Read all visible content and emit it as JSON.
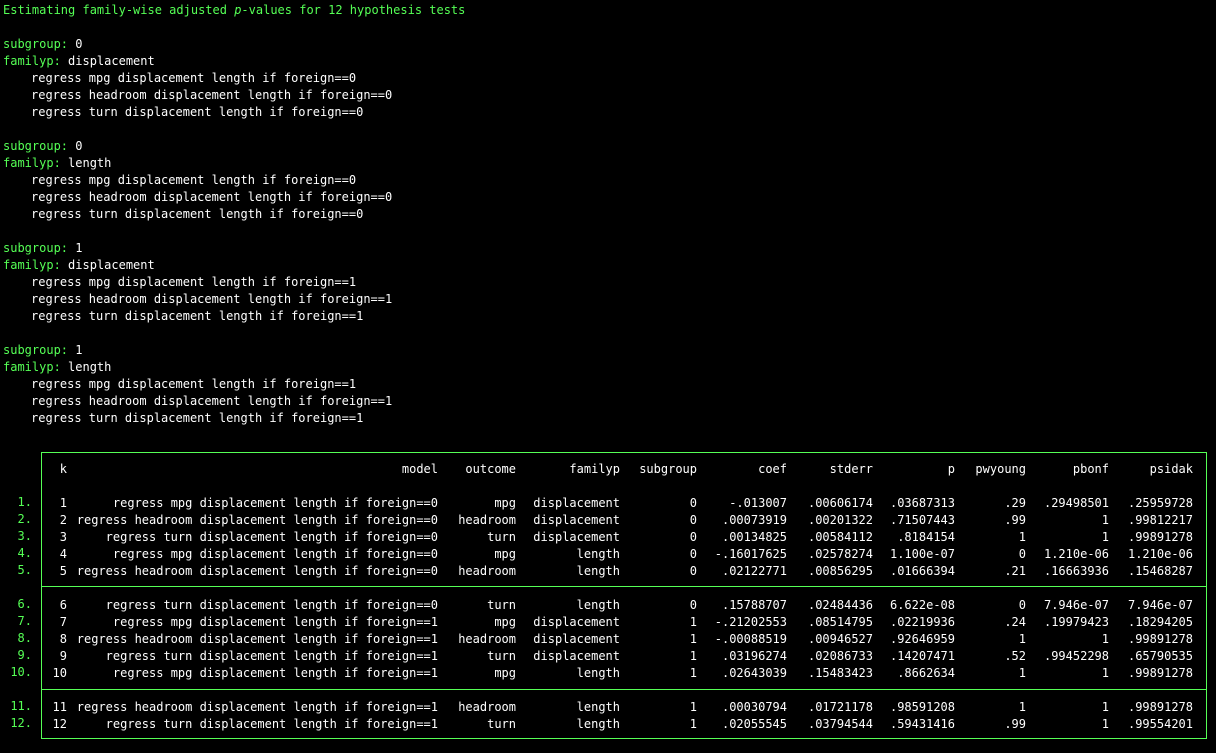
{
  "heading": {
    "prefix": "Estimating family-wise adjusted ",
    "italic": "p",
    "suffix": "-values for 12 hypothesis tests"
  },
  "blocks": [
    {
      "subgroup_label": "subgroup:",
      "subgroup_value": "0",
      "familyp_label": "familyp:",
      "familyp_value": "displacement",
      "commands": [
        "regress mpg displacement length if foreign==0",
        "regress headroom displacement length if foreign==0",
        "regress turn displacement length if foreign==0"
      ]
    },
    {
      "subgroup_label": "subgroup:",
      "subgroup_value": "0",
      "familyp_label": "familyp:",
      "familyp_value": "length",
      "commands": [
        "regress mpg displacement length if foreign==0",
        "regress headroom displacement length if foreign==0",
        "regress turn displacement length if foreign==0"
      ]
    },
    {
      "subgroup_label": "subgroup:",
      "subgroup_value": "1",
      "familyp_label": "familyp:",
      "familyp_value": "displacement",
      "commands": [
        "regress mpg displacement length if foreign==1",
        "regress headroom displacement length if foreign==1",
        "regress turn displacement length if foreign==1"
      ]
    },
    {
      "subgroup_label": "subgroup:",
      "subgroup_value": "1",
      "familyp_label": "familyp:",
      "familyp_value": "length",
      "commands": [
        "regress mpg displacement length if foreign==1",
        "regress headroom displacement length if foreign==1",
        "regress turn displacement length if foreign==1"
      ]
    }
  ],
  "table": {
    "headers": [
      "k",
      "model",
      "outcome",
      "familyp",
      "subgroup",
      "coef",
      "stderr",
      "p",
      "pwyoung",
      "pbonf",
      "psidak"
    ],
    "rows": [
      {
        "n": "1.",
        "k": "1",
        "model": "regress mpg displacement length if foreign==0",
        "outcome": "mpg",
        "familyp": "displacement",
        "subgroup": "0",
        "coef": "-.013007",
        "stderr": ".00606174",
        "p": ".03687313",
        "pwyoung": ".29",
        "pbonf": ".29498501",
        "psidak": ".25959728"
      },
      {
        "n": "2.",
        "k": "2",
        "model": "regress headroom displacement length if foreign==0",
        "outcome": "headroom",
        "familyp": "displacement",
        "subgroup": "0",
        "coef": ".00073919",
        "stderr": ".00201322",
        "p": ".71507443",
        "pwyoung": ".99",
        "pbonf": "1",
        "psidak": ".99812217"
      },
      {
        "n": "3.",
        "k": "3",
        "model": "regress turn displacement length if foreign==0",
        "outcome": "turn",
        "familyp": "displacement",
        "subgroup": "0",
        "coef": ".00134825",
        "stderr": ".00584112",
        "p": ".8184154",
        "pwyoung": "1",
        "pbonf": "1",
        "psidak": ".99891278"
      },
      {
        "n": "4.",
        "k": "4",
        "model": "regress mpg displacement length if foreign==0",
        "outcome": "mpg",
        "familyp": "length",
        "subgroup": "0",
        "coef": "-.16017625",
        "stderr": ".02578274",
        "p": "1.100e-07",
        "pwyoung": "0",
        "pbonf": "1.210e-06",
        "psidak": "1.210e-06"
      },
      {
        "n": "5.",
        "k": "5",
        "model": "regress headroom displacement length if foreign==0",
        "outcome": "headroom",
        "familyp": "length",
        "subgroup": "0",
        "coef": ".02122771",
        "stderr": ".00856295",
        "p": ".01666394",
        "pwyoung": ".21",
        "pbonf": ".16663936",
        "psidak": ".15468287"
      },
      {
        "n": "6.",
        "k": "6",
        "model": "regress turn displacement length if foreign==0",
        "outcome": "turn",
        "familyp": "length",
        "subgroup": "0",
        "coef": ".15788707",
        "stderr": ".02484436",
        "p": "6.622e-08",
        "pwyoung": "0",
        "pbonf": "7.946e-07",
        "psidak": "7.946e-07"
      },
      {
        "n": "7.",
        "k": "7",
        "model": "regress mpg displacement length if foreign==1",
        "outcome": "mpg",
        "familyp": "displacement",
        "subgroup": "1",
        "coef": "-.21202553",
        "stderr": ".08514795",
        "p": ".02219936",
        "pwyoung": ".24",
        "pbonf": ".19979423",
        "psidak": ".18294205"
      },
      {
        "n": "8.",
        "k": "8",
        "model": "regress headroom displacement length if foreign==1",
        "outcome": "headroom",
        "familyp": "displacement",
        "subgroup": "1",
        "coef": "-.00088519",
        "stderr": ".00946527",
        "p": ".92646959",
        "pwyoung": "1",
        "pbonf": "1",
        "psidak": ".99891278"
      },
      {
        "n": "9.",
        "k": "9",
        "model": "regress turn displacement length if foreign==1",
        "outcome": "turn",
        "familyp": "displacement",
        "subgroup": "1",
        "coef": ".03196274",
        "stderr": ".02086733",
        "p": ".14207471",
        "pwyoung": ".52",
        "pbonf": ".99452298",
        "psidak": ".65790535"
      },
      {
        "n": "10.",
        "k": "10",
        "model": "regress mpg displacement length if foreign==1",
        "outcome": "mpg",
        "familyp": "length",
        "subgroup": "1",
        "coef": ".02643039",
        "stderr": ".15483423",
        "p": ".8662634",
        "pwyoung": "1",
        "pbonf": "1",
        "psidak": ".99891278"
      },
      {
        "n": "11.",
        "k": "11",
        "model": "regress headroom displacement length if foreign==1",
        "outcome": "headroom",
        "familyp": "length",
        "subgroup": "1",
        "coef": ".00030794",
        "stderr": ".01721178",
        "p": ".98591208",
        "pwyoung": "1",
        "pbonf": "1",
        "psidak": ".99891278"
      },
      {
        "n": "12.",
        "k": "12",
        "model": "regress turn displacement length if foreign==1",
        "outcome": "turn",
        "familyp": "length",
        "subgroup": "1",
        "coef": ".02055545",
        "stderr": ".03794544",
        "p": ".59431416",
        "pwyoung": ".99",
        "pbonf": "1",
        "psidak": ".99554201"
      }
    ]
  },
  "colors": {
    "background": "#000000",
    "text": "#ffffff",
    "accent": "#55ff55"
  }
}
